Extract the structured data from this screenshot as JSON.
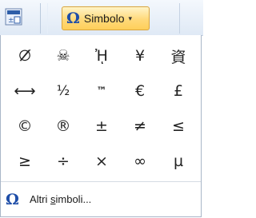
{
  "ribbon": {
    "button": {
      "icon": "omega-symbol-icon",
      "label": "Simbolo",
      "caret": "▾",
      "accent_color": "#1f4ea8"
    },
    "left_icon": "equation-icon"
  },
  "symbols": [
    "∅̸",
    "☠",
    "ᾘ",
    "¥",
    "資",
    "⟷",
    "½",
    "™",
    "€",
    "£",
    "©",
    "®",
    "±",
    "≠",
    "≤",
    "≥",
    "÷",
    "×",
    "∞",
    "µ"
  ],
  "footer": {
    "icon": "omega-symbol-icon",
    "label_pre": "Altri ",
    "label_mnemonic": "s",
    "label_post": "imboli..."
  }
}
